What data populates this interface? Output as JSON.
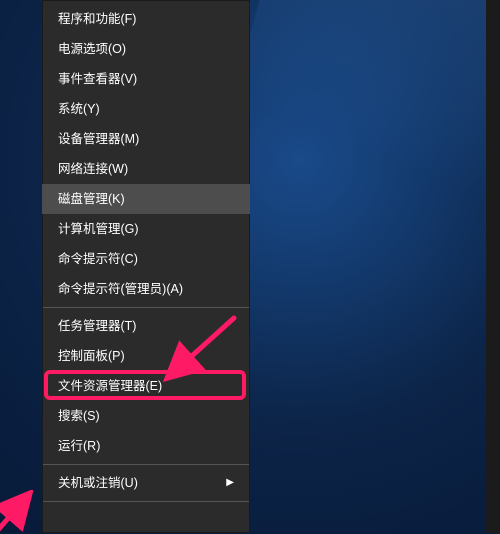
{
  "menu": {
    "groups": [
      [
        {
          "label": "程序和功能(F)"
        },
        {
          "label": "电源选项(O)"
        },
        {
          "label": "事件查看器(V)"
        },
        {
          "label": "系统(Y)"
        },
        {
          "label": "设备管理器(M)"
        },
        {
          "label": "网络连接(W)"
        },
        {
          "label": "磁盘管理(K)",
          "hover": true
        },
        {
          "label": "计算机管理(G)"
        },
        {
          "label": "命令提示符(C)"
        },
        {
          "label": "命令提示符(管理员)(A)"
        }
      ],
      [
        {
          "label": "任务管理器(T)"
        },
        {
          "label": "控制面板(P)",
          "highlighted": true
        },
        {
          "label": "文件资源管理器(E)"
        },
        {
          "label": "搜索(S)"
        },
        {
          "label": "运行(R)"
        }
      ],
      [
        {
          "label": "关机或注销(U)",
          "submenu": true
        }
      ]
    ]
  },
  "annotation": {
    "highlight_target": "控制面板(P)",
    "color": "#ff1a66"
  }
}
